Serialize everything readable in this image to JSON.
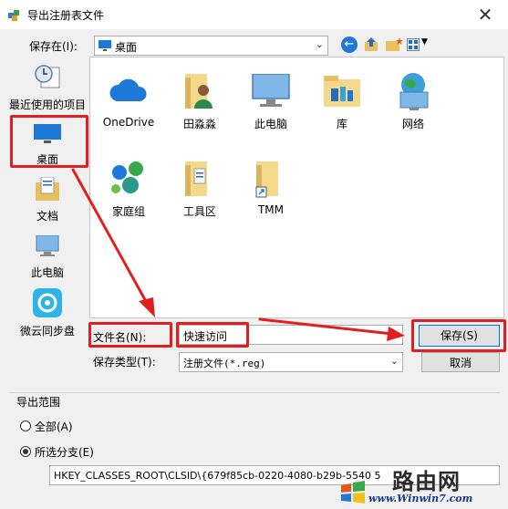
{
  "window": {
    "title": "导出注册表文件",
    "close": "✕"
  },
  "toolbar": {
    "save_in_label": "保存在(I):",
    "location": "桌面",
    "back_glyph": "←"
  },
  "sidebar": {
    "items": [
      {
        "label": "最近使用的项目"
      },
      {
        "label": "桌面"
      },
      {
        "label": "文档"
      },
      {
        "label": "此电脑"
      },
      {
        "label": "微云同步盘"
      }
    ]
  },
  "files": [
    {
      "label": "OneDrive"
    },
    {
      "label": "田淼淼"
    },
    {
      "label": "此电脑"
    },
    {
      "label": "库"
    },
    {
      "label": "网络"
    },
    {
      "label": "家庭组"
    },
    {
      "label": "工具区"
    },
    {
      "label": "TMM"
    }
  ],
  "form": {
    "filename_label": "文件名(N):",
    "filename_value": "快速访问",
    "filetype_label": "保存类型(T):",
    "filetype_value": "注册文件(*.reg)",
    "save_button": "保存(S)",
    "cancel_button": "取消"
  },
  "export_range": {
    "title": "导出范围",
    "all_label": "全部(A)",
    "selected_label": "所选分支(E)",
    "branch_path": "HKEY_CLASSES_ROOT\\CLSID\\{679f85cb-0220-4080-b29b-5540 5",
    "selected_option": "selected"
  },
  "watermark": {
    "brand": "路由网",
    "url": "www.Winwin7.com"
  },
  "colors": {
    "annotation_red": "#e02020",
    "accent_blue": "#1e78d7"
  }
}
